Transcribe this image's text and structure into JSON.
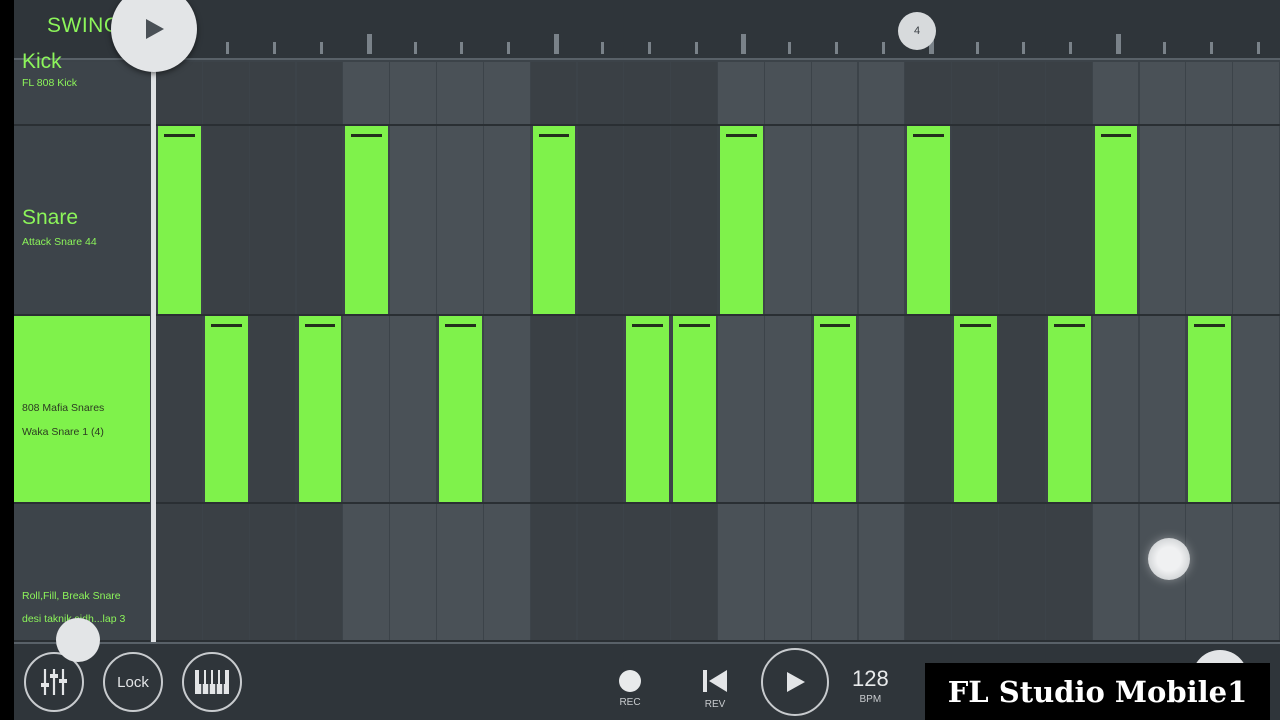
{
  "topbar": {
    "swing_label": "SWING",
    "position_marker": "4"
  },
  "channels": [
    {
      "name": "Kick",
      "sample": "FL 808 Kick",
      "selected": false
    },
    {
      "name": "Snare",
      "sample": "Attack Snare 44",
      "selected": false
    },
    {
      "name": "",
      "sample": "808 Mafia Snares",
      "sample2": "Waka Snare 1 (4)",
      "selected": true
    },
    {
      "name": "",
      "sample": "Roll,Fill, Break Snare",
      "sample2": "desi taknik sidh...lap 3",
      "selected": false
    }
  ],
  "step_rows": [
    {
      "steps": [
        0,
        0,
        0,
        0,
        0,
        0,
        0,
        0,
        0,
        0,
        0,
        0,
        0,
        0,
        0,
        0,
        0,
        0,
        0,
        0,
        0,
        0,
        0,
        0
      ]
    },
    {
      "steps": [
        1,
        0,
        0,
        0,
        1,
        0,
        0,
        0,
        1,
        0,
        0,
        0,
        1,
        0,
        0,
        0,
        1,
        0,
        0,
        0,
        1,
        0,
        0,
        0
      ]
    },
    {
      "steps": [
        0,
        1,
        0,
        1,
        0,
        0,
        1,
        0,
        0,
        0,
        1,
        1,
        0,
        0,
        1,
        0,
        0,
        1,
        0,
        1,
        0,
        0,
        1,
        0
      ]
    },
    {
      "steps": [
        0,
        0,
        0,
        0,
        0,
        0,
        0,
        0,
        0,
        0,
        0,
        0,
        0,
        0,
        0,
        0,
        0,
        0,
        0,
        0,
        0,
        0,
        0,
        0
      ]
    }
  ],
  "transport": {
    "mixer_icon": "mixer-icon",
    "lock_label": "Lock",
    "piano_icon": "piano-icon",
    "rec_label": "REC",
    "rev_label": "REV",
    "bpm_value": "128",
    "bpm_label": "BPM"
  },
  "watermark": "FL Studio Mobile1",
  "colors": {
    "accent": "#7ff24b",
    "background": "#3c4349",
    "bar": "#2f353a"
  }
}
